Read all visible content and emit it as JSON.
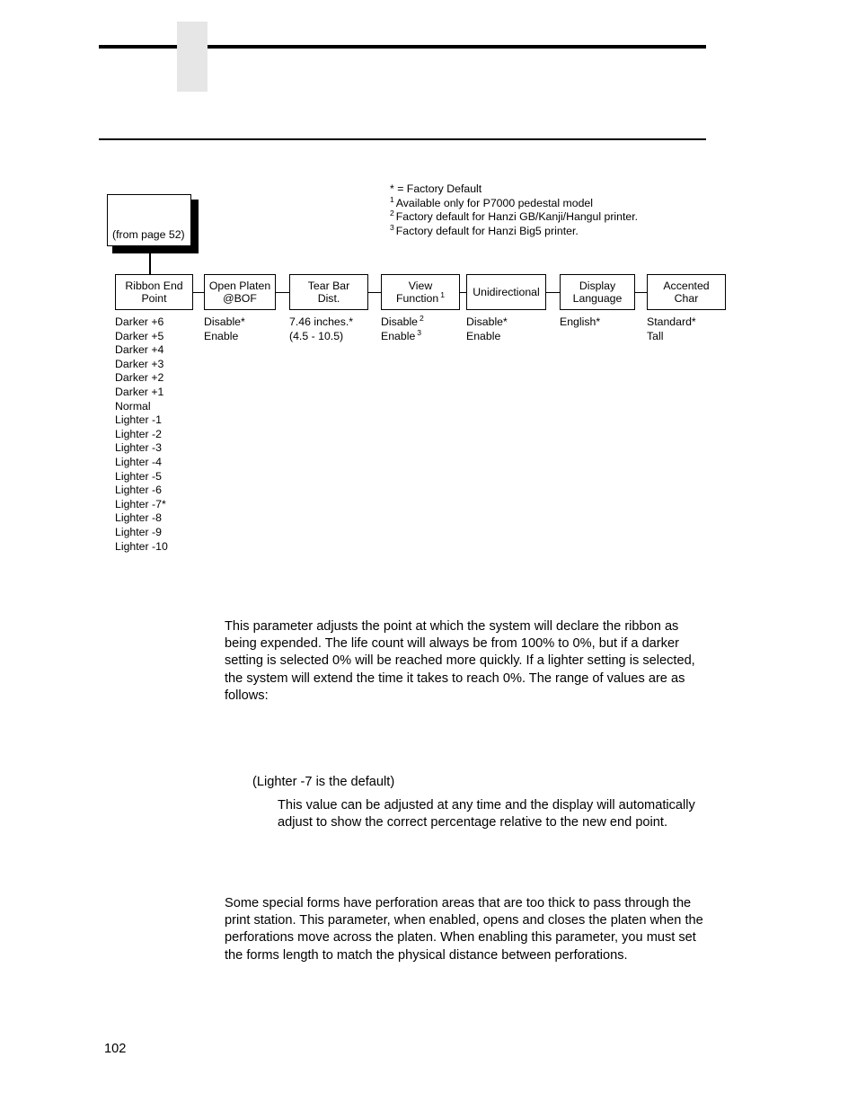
{
  "page": {
    "number": "102"
  },
  "legend": {
    "lines": [
      {
        "marker": "*",
        "superscript": false,
        "text": "= Factory Default"
      },
      {
        "marker": "1",
        "superscript": true,
        "text": "Available only for P7000 pedestal model"
      },
      {
        "marker": "2",
        "superscript": true,
        "text": "Factory default for Hanzi GB/Kanji/Hangul printer."
      },
      {
        "marker": "3",
        "superscript": true,
        "text": "Factory default for Hanzi Big5 printer."
      }
    ]
  },
  "flowchart": {
    "from_page_box": {
      "label": "(from page 52)"
    },
    "columns": [
      {
        "title_lines": [
          "Ribbon End",
          "Point"
        ],
        "title_superscript": "",
        "values": [
          {
            "text": "Darker +6",
            "superscript": ""
          },
          {
            "text": "Darker +5",
            "superscript": ""
          },
          {
            "text": "Darker +4",
            "superscript": ""
          },
          {
            "text": "Darker +3",
            "superscript": ""
          },
          {
            "text": "Darker +2",
            "superscript": ""
          },
          {
            "text": "Darker +1",
            "superscript": ""
          },
          {
            "text": "Normal",
            "superscript": ""
          },
          {
            "text": "Lighter -1",
            "superscript": ""
          },
          {
            "text": "Lighter -2",
            "superscript": ""
          },
          {
            "text": "Lighter -3",
            "superscript": ""
          },
          {
            "text": "Lighter -4",
            "superscript": ""
          },
          {
            "text": "Lighter -5",
            "superscript": ""
          },
          {
            "text": "Lighter -6",
            "superscript": ""
          },
          {
            "text": "Lighter -7*",
            "superscript": ""
          },
          {
            "text": "Lighter -8",
            "superscript": ""
          },
          {
            "text": "Lighter -9",
            "superscript": ""
          },
          {
            "text": "Lighter -10",
            "superscript": ""
          }
        ]
      },
      {
        "title_lines": [
          "Open Platen",
          "@BOF"
        ],
        "title_superscript": "",
        "values": [
          {
            "text": "Disable*",
            "superscript": ""
          },
          {
            "text": "Enable",
            "superscript": ""
          }
        ]
      },
      {
        "title_lines": [
          "Tear Bar",
          "Dist."
        ],
        "title_superscript": "",
        "values": [
          {
            "text": "7.46 inches.*",
            "superscript": ""
          },
          {
            "text": "(4.5 - 10.5)",
            "superscript": ""
          }
        ]
      },
      {
        "title_lines": [
          "View",
          "Function"
        ],
        "title_superscript": "1",
        "values": [
          {
            "text": "Disable",
            "superscript": "2"
          },
          {
            "text": "Enable",
            "superscript": "3"
          }
        ]
      },
      {
        "title_lines": [
          "Unidirectional"
        ],
        "title_superscript": "",
        "values": [
          {
            "text": "Disable*",
            "superscript": ""
          },
          {
            "text": "Enable",
            "superscript": ""
          }
        ]
      },
      {
        "title_lines": [
          "Display",
          "Language"
        ],
        "title_superscript": "",
        "values": [
          {
            "text": "English*",
            "superscript": ""
          }
        ]
      },
      {
        "title_lines": [
          "Accented",
          "Char"
        ],
        "title_superscript": "",
        "values": [
          {
            "text": "Standard*",
            "superscript": ""
          },
          {
            "text": "Tall",
            "superscript": ""
          }
        ]
      }
    ]
  },
  "body": {
    "ribbon_end_point": "This parameter adjusts the point at which the system will declare the ribbon as being expended. The life count will always be from 100% to 0%, but if a darker setting is selected 0% will be reached more quickly. If a lighter setting is selected, the system will extend the time it takes to reach 0%. The range of values are as follows:",
    "default_note": "(Lighter -7 is the default)",
    "adjust_note": "This value can be adjusted at any time and the display will automatically adjust to show the correct percentage relative to the new end point.",
    "open_platen": "Some special forms have perforation areas that are too thick to pass through the print station. This parameter, when enabled, opens and closes the platen when the perforations move across the platen. When enabling this parameter, you must set the forms length to match the physical distance between perforations."
  }
}
